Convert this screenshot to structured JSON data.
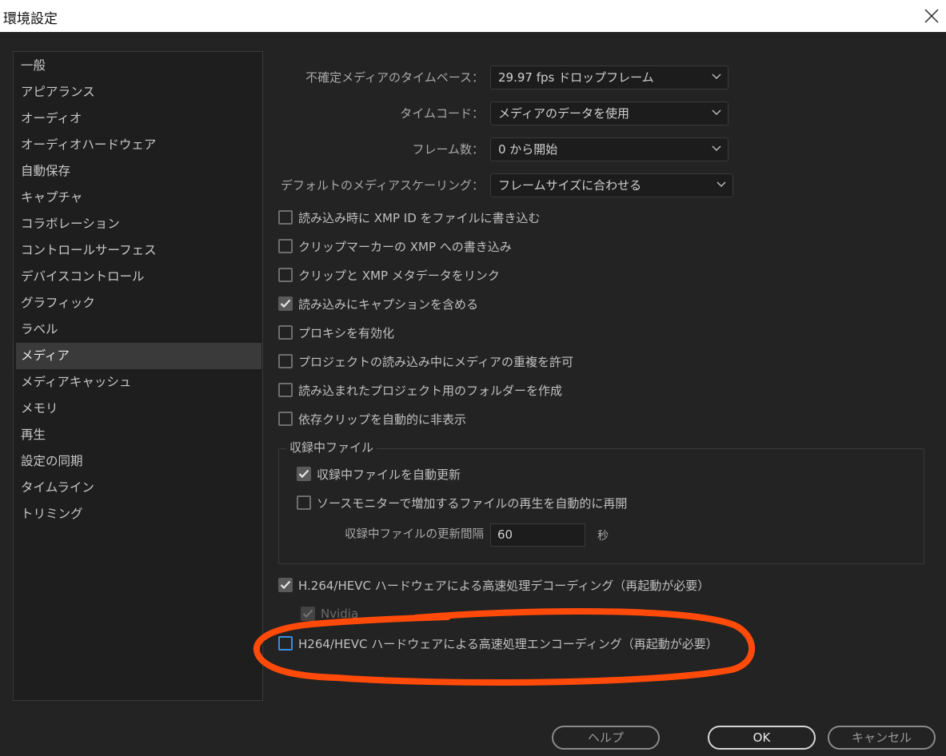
{
  "window": {
    "title": "環境設定"
  },
  "sidebar": {
    "items": [
      {
        "label": "一般"
      },
      {
        "label": "アピアランス"
      },
      {
        "label": "オーディオ"
      },
      {
        "label": "オーディオハードウェア"
      },
      {
        "label": "自動保存"
      },
      {
        "label": "キャプチャ"
      },
      {
        "label": "コラボレーション"
      },
      {
        "label": "コントロールサーフェス"
      },
      {
        "label": "デバイスコントロール"
      },
      {
        "label": "グラフィック"
      },
      {
        "label": "ラベル"
      },
      {
        "label": "メディア"
      },
      {
        "label": "メディアキャッシュ"
      },
      {
        "label": "メモリ"
      },
      {
        "label": "再生"
      },
      {
        "label": "設定の同期"
      },
      {
        "label": "タイムライン"
      },
      {
        "label": "トリミング"
      }
    ],
    "selected": "メディア"
  },
  "media": {
    "timebase_label": "不確定メディアのタイムベース：",
    "timebase_value": "29.97  fps  ドロップフレーム",
    "timecode_label": "タイムコード：",
    "timecode_value": "メディアのデータを使用",
    "frame_count_label": "フレーム数：",
    "frame_count_value": "0 から開始",
    "scaling_label": "デフォルトのメディアスケーリング：",
    "scaling_value": "フレームサイズに合わせる",
    "options": [
      {
        "label": "読み込み時に XMP ID をファイルに書き込む",
        "checked": false
      },
      {
        "label": "クリップマーカーの XMP への書き込み",
        "checked": false
      },
      {
        "label": "クリップと XMP メタデータをリンク",
        "checked": false
      },
      {
        "label": "読み込みにキャプションを含める",
        "checked": true
      },
      {
        "label": "プロキシを有効化",
        "checked": false
      },
      {
        "label": "プロジェクトの読み込み中にメディアの重複を許可",
        "checked": false
      },
      {
        "label": "読み込まれたプロジェクト用のフォルダーを作成",
        "checked": false
      },
      {
        "label": "依存クリップを自動的に非表示",
        "checked": false
      }
    ],
    "growing_files": {
      "title": "収録中ファイル",
      "auto_refresh_label": "収録中ファイルを自動更新",
      "auto_refresh_checked": true,
      "resume_label": "ソースモニターで増加するファイルの再生を自動的に再開",
      "resume_checked": false,
      "interval_label": "収録中ファイルの更新間隔",
      "interval_value": "60",
      "interval_unit": "秒"
    },
    "hw_decode": {
      "label": "H.264/HEVC ハードウェアによる高速処理デコーディング（再起動が必要）",
      "checked": true
    },
    "nvidia": {
      "label": "Nvidia",
      "checked": true,
      "disabled": true
    },
    "hw_encode": {
      "label": "H264/HEVC ハードウェアによる高速処理エンコーディング（再起動が必要）",
      "checked": false
    }
  },
  "buttons": {
    "help": "ヘルプ",
    "ok": "OK",
    "cancel": "キャンセル"
  },
  "colors": {
    "annotation": "#ff4a0a",
    "focus": "#3b8ddd",
    "background": "#232323"
  }
}
